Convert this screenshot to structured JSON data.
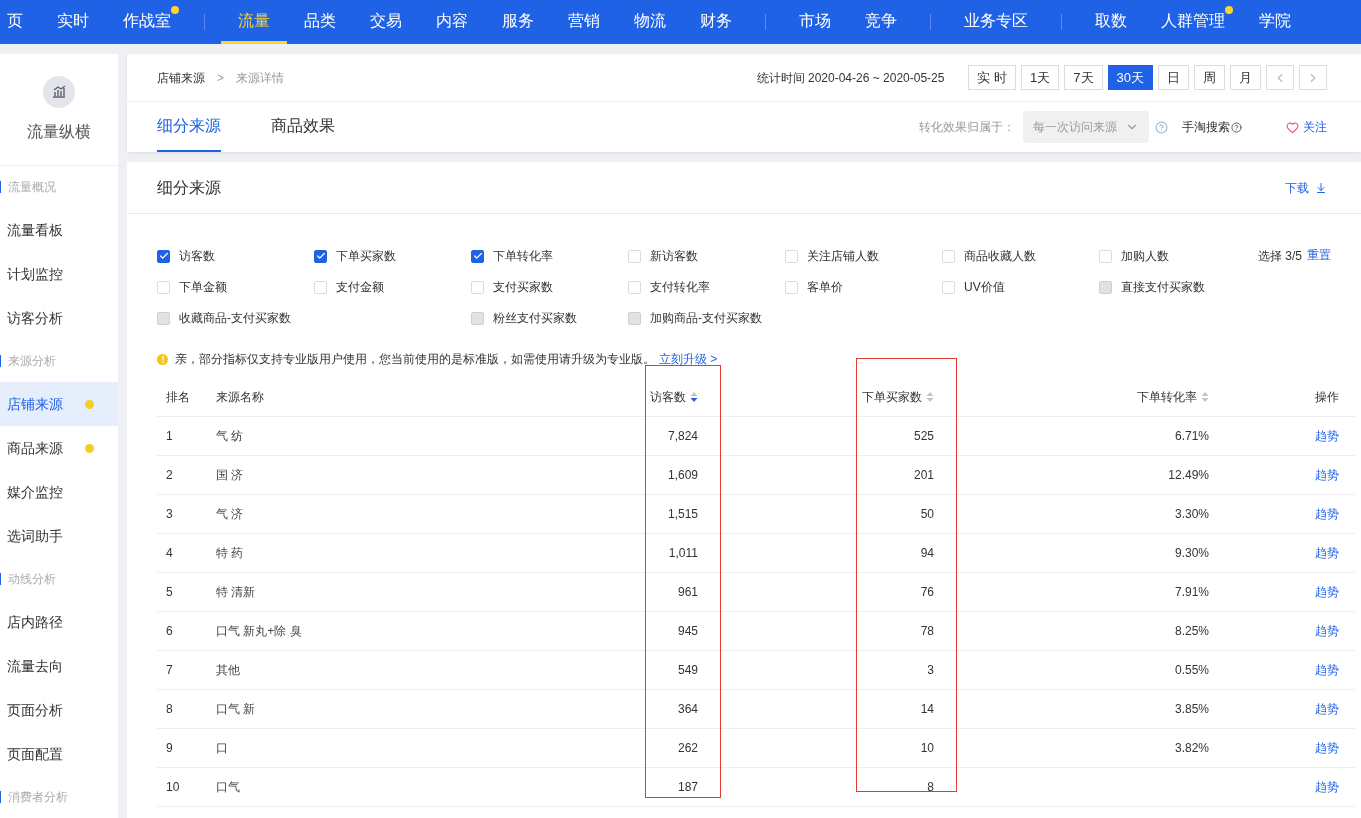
{
  "top_nav": [
    {
      "label": "页",
      "selected": false,
      "dot": false,
      "divider_before": false
    },
    {
      "label": "实时",
      "selected": false,
      "dot": false,
      "divider_before": false
    },
    {
      "label": "作战室",
      "selected": false,
      "dot": true,
      "divider_before": false
    },
    {
      "label": "流量",
      "selected": true,
      "dot": false,
      "divider_before": true
    },
    {
      "label": "品类",
      "selected": false,
      "dot": false,
      "divider_before": false
    },
    {
      "label": "交易",
      "selected": false,
      "dot": false,
      "divider_before": false
    },
    {
      "label": "内容",
      "selected": false,
      "dot": false,
      "divider_before": false
    },
    {
      "label": "服务",
      "selected": false,
      "dot": false,
      "divider_before": false
    },
    {
      "label": "营销",
      "selected": false,
      "dot": false,
      "divider_before": false
    },
    {
      "label": "物流",
      "selected": false,
      "dot": false,
      "divider_before": false
    },
    {
      "label": "财务",
      "selected": false,
      "dot": false,
      "divider_before": false
    },
    {
      "label": "市场",
      "selected": false,
      "dot": false,
      "divider_before": true
    },
    {
      "label": "竞争",
      "selected": false,
      "dot": false,
      "divider_before": false
    },
    {
      "label": "业务专区",
      "selected": false,
      "dot": false,
      "divider_before": true
    },
    {
      "label": "取数",
      "selected": false,
      "dot": false,
      "divider_before": true
    },
    {
      "label": "人群管理",
      "selected": false,
      "dot": true,
      "divider_before": false
    },
    {
      "label": "学院",
      "selected": false,
      "dot": false,
      "divider_before": false
    }
  ],
  "sidebar": {
    "title": "流量纵横",
    "groups": [
      {
        "label": "流量概况",
        "children": [
          {
            "label": "流量看板",
            "selected": false,
            "dot": false
          },
          {
            "label": "计划监控",
            "selected": false,
            "dot": false
          },
          {
            "label": "访客分析",
            "selected": false,
            "dot": false
          }
        ]
      },
      {
        "label": "来源分析",
        "children": [
          {
            "label": "店铺来源",
            "selected": true,
            "dot": true
          },
          {
            "label": "商品来源",
            "selected": false,
            "dot": true
          },
          {
            "label": "媒介监控",
            "selected": false,
            "dot": false
          },
          {
            "label": "选词助手",
            "selected": false,
            "dot": false
          }
        ]
      },
      {
        "label": "动线分析",
        "children": [
          {
            "label": "店内路径",
            "selected": false,
            "dot": false
          },
          {
            "label": "流量去向",
            "selected": false,
            "dot": false
          },
          {
            "label": "页面分析",
            "selected": false,
            "dot": false
          },
          {
            "label": "页面配置",
            "selected": false,
            "dot": false
          }
        ]
      },
      {
        "label": "消费者分析"
      }
    ]
  },
  "breadcrumb": [
    "店铺来源",
    ">",
    "来源详情"
  ],
  "stat_time": "统计时间 2020-04-26 ~ 2020-05-25",
  "period_buttons": [
    {
      "label": "实 时",
      "selected": false
    },
    {
      "label": "1天",
      "selected": false
    },
    {
      "label": "7天",
      "selected": false
    },
    {
      "label": "30天",
      "selected": true
    },
    {
      "label": "日",
      "selected": false
    },
    {
      "label": "周",
      "selected": false
    },
    {
      "label": "月",
      "selected": false
    }
  ],
  "tabs": [
    {
      "label": "细分来源",
      "selected": true
    },
    {
      "label": "商品效果",
      "selected": false
    }
  ],
  "attribution": {
    "label": "转化效果归属于：",
    "value": "每一次访问来源",
    "disabled": true
  },
  "search_source": "手淘搜索",
  "follow": "关注",
  "section": {
    "title": "细分来源",
    "download": "下载"
  },
  "metrics": [
    [
      {
        "label": "访客数",
        "checked": true,
        "disabled": false
      },
      {
        "label": "下单买家数",
        "checked": true,
        "disabled": false
      },
      {
        "label": "下单转化率",
        "checked": true,
        "disabled": false
      },
      {
        "label": "新访客数",
        "checked": false,
        "disabled": false
      },
      {
        "label": "关注店铺人数",
        "checked": false,
        "disabled": false
      },
      {
        "label": "商品收藏人数",
        "checked": false,
        "disabled": false
      },
      {
        "label": "加购人数",
        "checked": false,
        "disabled": false
      }
    ],
    [
      {
        "label": "下单金额",
        "checked": false,
        "disabled": false
      },
      {
        "label": "支付金额",
        "checked": false,
        "disabled": false
      },
      {
        "label": "支付买家数",
        "checked": false,
        "disabled": false
      },
      {
        "label": "支付转化率",
        "checked": false,
        "disabled": false
      },
      {
        "label": "客单价",
        "checked": false,
        "disabled": false
      },
      {
        "label": "UV价值",
        "checked": false,
        "disabled": false
      },
      {
        "label": "直接支付买家数",
        "checked": false,
        "disabled": true
      }
    ],
    [
      {
        "label": "收藏商品-支付买家数",
        "checked": false,
        "disabled": true
      },
      {
        "label": "粉丝支付买家数",
        "checked": false,
        "disabled": true
      },
      {
        "label": "加购商品-支付买家数",
        "checked": false,
        "disabled": true
      }
    ]
  ],
  "selection": {
    "count": "选择 3/5",
    "reset": "重置"
  },
  "notice": {
    "text": "亲，部分指标仅支持专业版用户使用，您当前使用的是标准版，如需使用请升级为专业版。",
    "link": "立刻升级 >"
  },
  "table": {
    "columns": [
      {
        "label": "排名",
        "highlighted": false
      },
      {
        "label": "来源名称",
        "highlighted": false
      },
      {
        "label": "访客数",
        "sorted": true,
        "highlighted": true
      },
      {
        "label": "下单买家数",
        "sorted": false,
        "highlighted": true
      },
      {
        "label": "下单转化率",
        "sorted": false,
        "highlighted": false
      },
      {
        "label": "操作",
        "highlighted": false
      }
    ],
    "rows": [
      {
        "rank": "1",
        "name": "气 纺",
        "visitors": "7,824",
        "buyers": "525",
        "rate": "6.71%",
        "action": "趋势"
      },
      {
        "rank": "2",
        "name": "国 济",
        "visitors": "1,609",
        "buyers": "201",
        "rate": "12.49%",
        "action": "趋势"
      },
      {
        "rank": "3",
        "name": "气 济",
        "visitors": "1,515",
        "buyers": "50",
        "rate": "3.30%",
        "action": "趋势"
      },
      {
        "rank": "4",
        "name": "特 药",
        "visitors": "1,011",
        "buyers": "94",
        "rate": "9.30%",
        "action": "趋势"
      },
      {
        "rank": "5",
        "name": "特 清新",
        "visitors": "961",
        "buyers": "76",
        "rate": "7.91%",
        "action": "趋势"
      },
      {
        "rank": "6",
        "name": "口气 新丸+除 臭",
        "visitors": "945",
        "buyers": "78",
        "rate": "8.25%",
        "action": "趋势"
      },
      {
        "rank": "7",
        "name": "其他",
        "visitors": "549",
        "buyers": "3",
        "rate": "0.55%",
        "action": "趋势"
      },
      {
        "rank": "8",
        "name": "口气 新",
        "visitors": "364",
        "buyers": "14",
        "rate": "3.85%",
        "action": "趋势"
      },
      {
        "rank": "9",
        "name": "口",
        "visitors": "262",
        "buyers": "10",
        "rate": "3.82%",
        "action": "趋势"
      },
      {
        "rank": "10",
        "name": "口气",
        "visitors": "187",
        "buyers": "8",
        "action": "趋势"
      }
    ]
  }
}
